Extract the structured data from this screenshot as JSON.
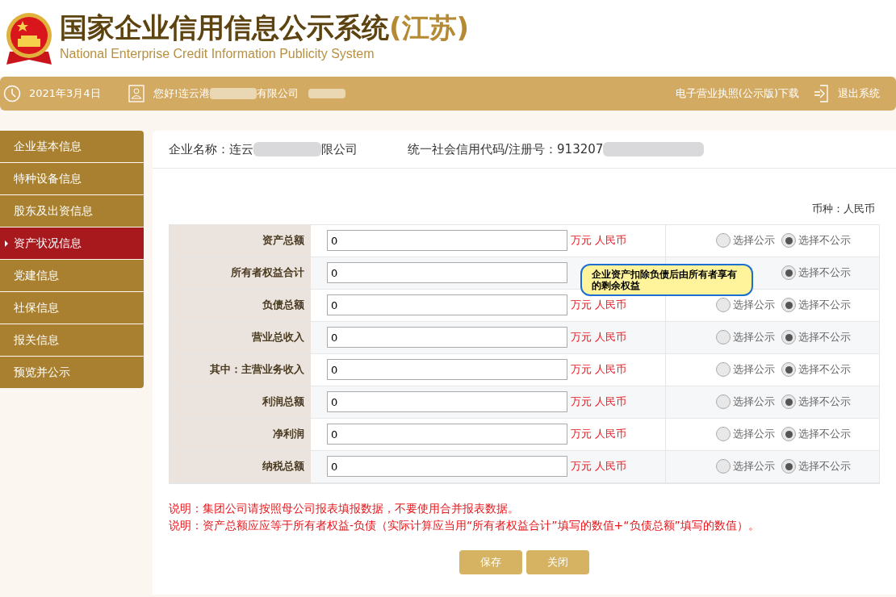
{
  "header": {
    "title": "国家企业信用信息公示系统",
    "region": "(江苏)",
    "subtitle": "National Enterprise Credit Information Publicity System"
  },
  "top_bar": {
    "date": "2021年3月4日",
    "greeting_start": "您好!连云港",
    "greeting_end": "有限公司",
    "license_download": "电子营业执照(公示版)下载",
    "logout": "退出系统"
  },
  "sidebar": {
    "items": [
      {
        "label": "企业基本信息",
        "selected": false
      },
      {
        "label": "特种设备信息",
        "selected": false
      },
      {
        "label": "股东及出资信息",
        "selected": false
      },
      {
        "label": "资产状况信息",
        "selected": true
      },
      {
        "label": "党建信息",
        "selected": false
      },
      {
        "label": "社保信息",
        "selected": false
      },
      {
        "label": "报关信息",
        "selected": false
      },
      {
        "label": "预览并公示",
        "selected": false
      }
    ]
  },
  "company": {
    "name_start": "企业名称：连云",
    "name_end": "限公司",
    "credit_code": "统一社会信用代码/注册号：913207"
  },
  "currency": "币种：人民币",
  "rows": [
    {
      "label": "资产总额",
      "value": "0",
      "unit": "万元 人民币",
      "options": [
        {
          "label": "选择公示",
          "selected": false
        },
        {
          "label": "选择不公示",
          "selected": true
        }
      ]
    },
    {
      "label": "所有者权益合计",
      "value": "0",
      "options": [
        {
          "label": "选择不公示",
          "selected": true
        }
      ]
    },
    {
      "label": "负债总额",
      "value": "0",
      "unit": "万元 人民币",
      "options": [
        {
          "label": "选择公示",
          "selected": false
        },
        {
          "label": "选择不公示",
          "selected": true
        }
      ]
    },
    {
      "label": "营业总收入",
      "value": "0",
      "unit": "万元 人民币",
      "options": [
        {
          "label": "选择公示",
          "selected": false
        },
        {
          "label": "选择不公示",
          "selected": true
        }
      ]
    },
    {
      "label": "其中：主营业务收入",
      "value": "0",
      "unit": "万元 人民币",
      "options": [
        {
          "label": "选择公示",
          "selected": false
        },
        {
          "label": "选择不公示",
          "selected": true
        }
      ]
    },
    {
      "label": "利润总额",
      "value": "0",
      "unit": "万元 人民币",
      "options": [
        {
          "label": "选择公示",
          "selected": false
        },
        {
          "label": "选择不公示",
          "selected": true
        }
      ]
    },
    {
      "label": "净利润",
      "value": "0",
      "unit": "万元 人民币",
      "options": [
        {
          "label": "选择公示",
          "selected": false
        },
        {
          "label": "选择不公示",
          "selected": true
        }
      ]
    },
    {
      "label": "纳税总额",
      "value": "0",
      "unit": "万元 人民币",
      "options": [
        {
          "label": "选择公示",
          "selected": false
        },
        {
          "label": "选择不公示",
          "selected": true
        }
      ]
    }
  ],
  "tooltip": "企业资产扣除负债后由所有者享有的剩余权益",
  "notes": [
    "说明：集团公司请按照母公司报表填报数据，不要使用合并报表数据。",
    "说明：资产总额应应等于所有者权益-负债（实际计算应当用“所有者权益合计”填写的数值+“负债总额”填写的数值）。"
  ],
  "buttons": [
    "保存",
    "关闭"
  ]
}
